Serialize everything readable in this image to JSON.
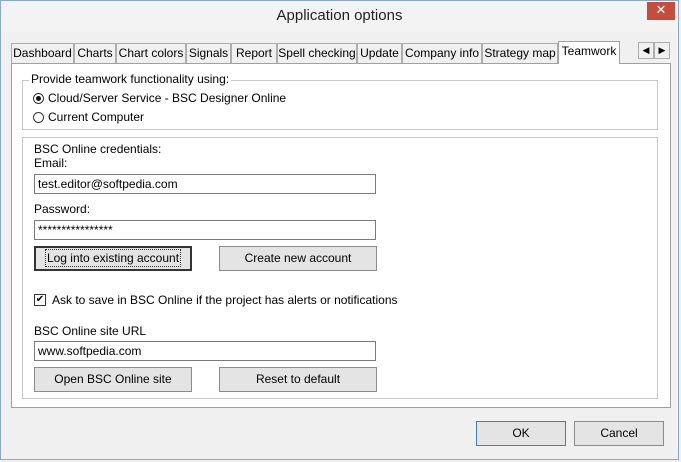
{
  "window": {
    "title": "Application options",
    "close_glyph": "✕"
  },
  "tabs": [
    {
      "label": "Dashboard"
    },
    {
      "label": "Charts"
    },
    {
      "label": "Chart colors"
    },
    {
      "label": "Signals"
    },
    {
      "label": "Report"
    },
    {
      "label": "Spell checking"
    },
    {
      "label": "Update"
    },
    {
      "label": "Company info"
    },
    {
      "label": "Strategy map"
    },
    {
      "label": "Teamwork",
      "active": true
    }
  ],
  "tab_scroll": {
    "left_glyph": "◀",
    "right_glyph": "▶"
  },
  "teamwork": {
    "group_label": "Provide teamwork functionality using:",
    "options": [
      {
        "label": "Cloud/Server Service - BSC Designer Online",
        "selected": true
      },
      {
        "label": "Current Computer",
        "selected": false
      }
    ]
  },
  "credentials": {
    "group_label": "BSC Online credentials:",
    "email_label": "Email:",
    "email_value": "test.editor@softpedia.com",
    "password_label": "Password:",
    "password_value": "****************",
    "login_button": "Log into existing account",
    "create_button": "Create new account",
    "ask_save_checkbox": {
      "label": "Ask to save in BSC Online if the project has alerts or notifications",
      "checked": true,
      "glyph": "✔"
    },
    "site_url_label": "BSC Online site URL",
    "site_url_value": "www.softpedia.com",
    "open_site_button": "Open BSC Online site",
    "reset_button": "Reset to default"
  },
  "footer": {
    "ok_button": "OK",
    "cancel_button": "Cancel"
  }
}
